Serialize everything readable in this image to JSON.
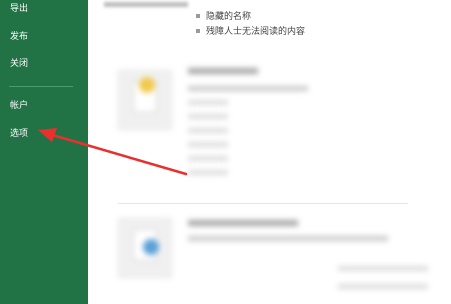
{
  "sidebar": {
    "items": [
      {
        "id": "export",
        "label": "导出"
      },
      {
        "id": "publish",
        "label": "发布"
      },
      {
        "id": "close",
        "label": "关闭"
      },
      {
        "id": "account",
        "label": "帐户"
      },
      {
        "id": "options",
        "label": "选项"
      }
    ],
    "background": "#217346"
  },
  "inspect_list": {
    "items": [
      {
        "label": "隐藏的名称"
      },
      {
        "label": "残障人士无法阅读的内容"
      }
    ]
  },
  "annotation": {
    "arrow_color": "#e8312f",
    "target": "options"
  }
}
